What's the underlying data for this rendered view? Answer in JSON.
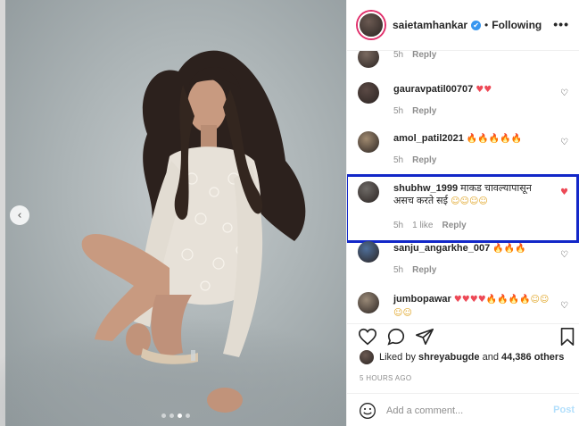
{
  "post": {
    "author": "saietamhankar",
    "verified_mark": "✔",
    "separator": "•",
    "follow_status": "Following",
    "more_label": "•••",
    "image_dots": 4,
    "active_dot": 2,
    "prev_label": "‹"
  },
  "comments": [
    {
      "user": "",
      "text": "",
      "time": "5h",
      "likes": "",
      "reply": "Reply",
      "liked": false
    },
    {
      "user": "gauravpatil00707",
      "text": "",
      "emoji": [
        {
          "g": "♥",
          "k": "red"
        },
        {
          "g": "♥",
          "k": "red"
        }
      ],
      "time": "5h",
      "likes": "",
      "reply": "Reply",
      "liked": false
    },
    {
      "user": "amol_patil2021",
      "text": "",
      "emoji": [
        {
          "g": "🔥",
          "k": "fire"
        },
        {
          "g": "🔥",
          "k": "fire"
        },
        {
          "g": "🔥",
          "k": "fire"
        },
        {
          "g": "🔥",
          "k": "fire"
        },
        {
          "g": "🔥",
          "k": "fire"
        }
      ],
      "time": "5h",
      "likes": "",
      "reply": "Reply",
      "liked": false
    },
    {
      "user": "shubhw_1999",
      "text": "माकड चावल्यापासून असच करते सई",
      "emoji": [
        {
          "g": "☺",
          "k": "face"
        },
        {
          "g": "☺",
          "k": "face"
        },
        {
          "g": "☺",
          "k": "face"
        },
        {
          "g": "☺",
          "k": "face"
        }
      ],
      "time": "5h",
      "likes": "1 like",
      "reply": "Reply",
      "liked": true
    },
    {
      "user": "sanju_angarkhe_007",
      "text": "",
      "emoji": [
        {
          "g": "🔥",
          "k": "fire"
        },
        {
          "g": "🔥",
          "k": "fire"
        },
        {
          "g": "🔥",
          "k": "fire"
        }
      ],
      "time": "5h",
      "likes": "",
      "reply": "Reply",
      "liked": false
    },
    {
      "user": "jumbopawar",
      "text": "",
      "emoji": [
        {
          "g": "♥",
          "k": "red"
        },
        {
          "g": "♥",
          "k": "red"
        },
        {
          "g": "♥",
          "k": "red"
        },
        {
          "g": "♥",
          "k": "red"
        },
        {
          "g": "🔥",
          "k": "fire"
        },
        {
          "g": "🔥",
          "k": "fire"
        },
        {
          "g": "🔥",
          "k": "fire"
        },
        {
          "g": "🔥",
          "k": "fire"
        },
        {
          "g": "☺",
          "k": "face"
        },
        {
          "g": "☺",
          "k": "face"
        },
        {
          "g": "☺",
          "k": "face"
        },
        {
          "g": "☺",
          "k": "face"
        }
      ],
      "time": "",
      "likes": "",
      "reply": "",
      "liked": false
    }
  ],
  "likes": {
    "prefix": "Liked by",
    "user": "shreyabugde",
    "joiner": "and",
    "count": "44,386 others"
  },
  "time_ago": "5 HOURS AGO",
  "composer": {
    "placeholder": "Add a comment...",
    "post_label": "Post"
  },
  "icons": {
    "like": "heart-outline-icon",
    "comment": "speech-bubble-icon",
    "share": "paper-plane-icon",
    "save": "bookmark-icon",
    "emoji": "smiley-icon"
  },
  "colors": {
    "highlight_box": "#1227c8",
    "link_blue": "#3897f0",
    "like_red": "#ed4956",
    "muted": "#8e8e8e"
  }
}
